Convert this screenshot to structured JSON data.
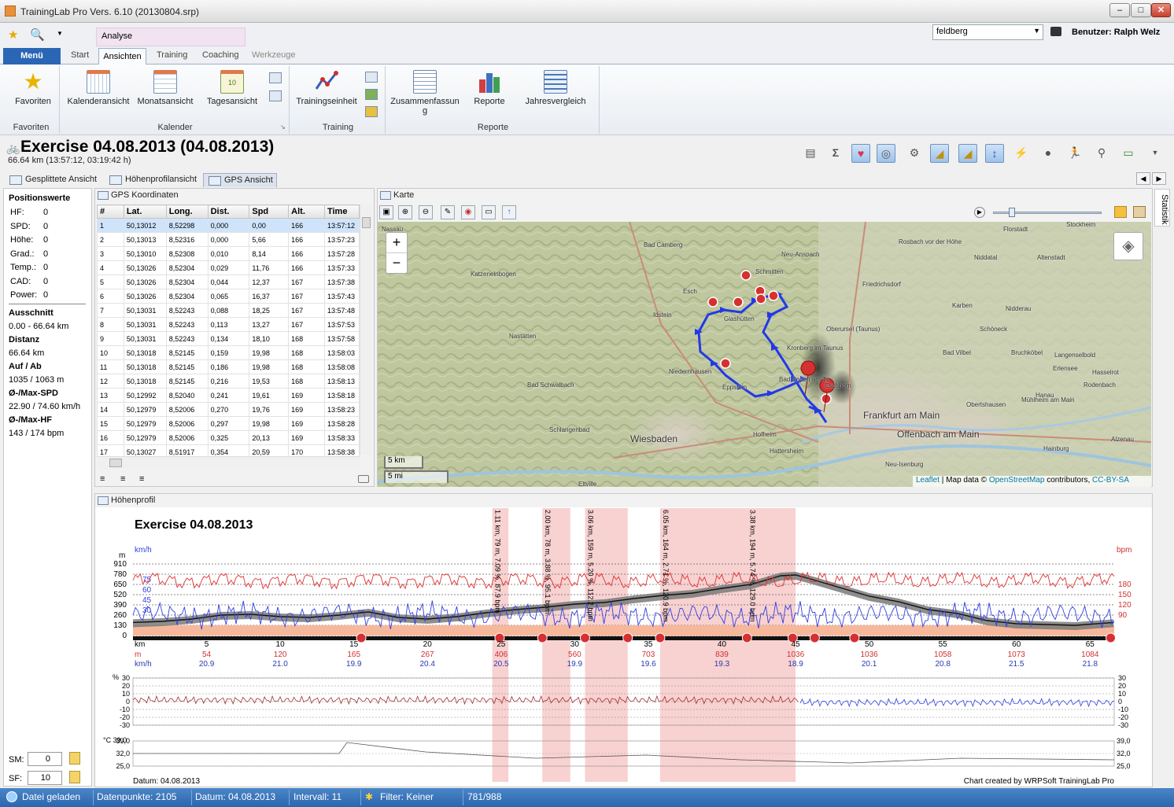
{
  "window": {
    "title": "TrainingLab Pro Vers. 6.10 (20130804.srp)",
    "min": "–",
    "max": "□",
    "close": "✕"
  },
  "context_tab": "Analyse",
  "profile_select": "feldberg",
  "user": "Benutzer: Ralph Welz",
  "tabs": {
    "menu": "Menü",
    "items": [
      "Start",
      "Ansichten",
      "Training",
      "Coaching",
      "Werkzeuge"
    ]
  },
  "ribbon": {
    "favoriten": {
      "button": "Favoriten",
      "group": "Favoriten"
    },
    "kalender": {
      "buttons": [
        "Kalenderansicht",
        "Monatsansicht",
        "Tagesansicht"
      ],
      "group": "Kalender"
    },
    "training": {
      "button": "Trainingseinheit",
      "group": "Training"
    },
    "reporte": {
      "buttons": [
        "Zusammenfassung",
        "Reporte",
        "Jahresvergleich"
      ],
      "group": "Reporte"
    }
  },
  "exercise": {
    "title": "Exercise 04.08.2013 (04.08.2013)",
    "subtitle": "66.64 km (13:57:12, 03:19:42 h)"
  },
  "view_tabs": [
    "Gesplittete Ansicht",
    "Höhenprofilansicht",
    "GPS Ansicht"
  ],
  "left_panel": {
    "title": "Positionswerte",
    "rows": [
      {
        "label": "HF:",
        "value": "0"
      },
      {
        "label": "SPD:",
        "value": "0"
      },
      {
        "label": "Höhe:",
        "value": "0"
      },
      {
        "label": "Grad.:",
        "value": "0"
      },
      {
        "label": "Temp.:",
        "value": "0"
      },
      {
        "label": "CAD:",
        "value": "0"
      },
      {
        "label": "Power:",
        "value": "0"
      }
    ],
    "sections": [
      {
        "head": "Ausschnitt",
        "value": "0.00 - 66.64 km"
      },
      {
        "head": "Distanz",
        "value": "66.64 km"
      },
      {
        "head": "Auf / Ab",
        "value": "1035 / 1063 m"
      },
      {
        "head": "Ø-/Max-SPD",
        "value": "22.90 / 74.60 km/h"
      },
      {
        "head": "Ø-/Max-HF",
        "value": "143 / 174 bpm"
      }
    ],
    "sm_label": "SM:",
    "sm_value": "0",
    "sf_label": "SF:",
    "sf_value": "10"
  },
  "gps": {
    "title": "GPS Koordinaten",
    "columns": [
      "#",
      "Lat.",
      "Long.",
      "Dist.",
      "Spd",
      "Alt.",
      "Time"
    ],
    "rows": [
      [
        "1",
        "50,13012",
        "8,52298",
        "0,000",
        "0,00",
        "166",
        "13:57:12"
      ],
      [
        "2",
        "50,13013",
        "8,52316",
        "0,000",
        "5,66",
        "166",
        "13:57:23"
      ],
      [
        "3",
        "50,13010",
        "8,52308",
        "0,010",
        "8,14",
        "166",
        "13:57:28"
      ],
      [
        "4",
        "50,13026",
        "8,52304",
        "0,029",
        "11,76",
        "166",
        "13:57:33"
      ],
      [
        "5",
        "50,13026",
        "8,52304",
        "0,044",
        "12,37",
        "167",
        "13:57:38"
      ],
      [
        "6",
        "50,13026",
        "8,52304",
        "0,065",
        "16,37",
        "167",
        "13:57:43"
      ],
      [
        "7",
        "50,13031",
        "8,52243",
        "0,088",
        "18,25",
        "167",
        "13:57:48"
      ],
      [
        "8",
        "50,13031",
        "8,52243",
        "0,113",
        "13,27",
        "167",
        "13:57:53"
      ],
      [
        "9",
        "50,13031",
        "8,52243",
        "0,134",
        "18,10",
        "168",
        "13:57:58"
      ],
      [
        "10",
        "50,13018",
        "8,52145",
        "0,159",
        "19,98",
        "168",
        "13:58:03"
      ],
      [
        "11",
        "50,13018",
        "8,52145",
        "0,186",
        "19,98",
        "168",
        "13:58:08"
      ],
      [
        "12",
        "50,13018",
        "8,52145",
        "0,216",
        "19,53",
        "168",
        "13:58:13"
      ],
      [
        "13",
        "50,12992",
        "8,52040",
        "0,241",
        "19,61",
        "169",
        "13:58:18"
      ],
      [
        "14",
        "50,12979",
        "8,52006",
        "0,270",
        "19,76",
        "169",
        "13:58:23"
      ],
      [
        "15",
        "50,12979",
        "8,52006",
        "0,297",
        "19,98",
        "169",
        "13:58:28"
      ],
      [
        "16",
        "50,12979",
        "8,52006",
        "0,325",
        "20,13",
        "169",
        "13:58:33"
      ],
      [
        "17",
        "50,13027",
        "8,51917",
        "0,354",
        "20,59",
        "170",
        "13:58:38"
      ]
    ]
  },
  "map": {
    "title": "Karte",
    "zoom_in": "+",
    "zoom_out": "−",
    "scale_km": "5 km",
    "scale_mi": "5 mi",
    "attribution": {
      "leaflet": "Leaflet",
      "mid": " | Map data © ",
      "osm": "OpenStreetMap",
      "contrib": " contributors, ",
      "license": "CC-BY-SA"
    },
    "places": [
      {
        "name": "Bad Camberg",
        "size": "s"
      },
      {
        "name": "Neu-Anspach",
        "size": "s"
      },
      {
        "name": "Rosbach vor der Höhe",
        "size": "s"
      },
      {
        "name": "Florstadt",
        "size": "s"
      },
      {
        "name": "Katzenelnbogen",
        "size": "s"
      },
      {
        "name": "Friedrichsdorf",
        "size": "s"
      },
      {
        "name": "Altenstadt",
        "size": "s"
      },
      {
        "name": "Stockheim",
        "size": "s"
      },
      {
        "name": "Niddatal",
        "size": "s"
      },
      {
        "name": "Esch",
        "size": "s"
      },
      {
        "name": "Schmitten",
        "size": "s"
      },
      {
        "name": "Idstein",
        "size": "s"
      },
      {
        "name": "Glashütten",
        "size": "s"
      },
      {
        "name": "Karben",
        "size": "s"
      },
      {
        "name": "Nidderau",
        "size": "s"
      },
      {
        "name": "Oberursel (Taunus)",
        "size": "s"
      },
      {
        "name": "Schöneck",
        "size": "s"
      },
      {
        "name": "Nastätten",
        "size": "s"
      },
      {
        "name": "Kronberg im Taunus",
        "size": "s"
      },
      {
        "name": "Bad Vilbel",
        "size": "s"
      },
      {
        "name": "Bruchköbel",
        "size": "s"
      },
      {
        "name": "Langenselbold",
        "size": "s"
      },
      {
        "name": "Niedernhausen",
        "size": "s"
      },
      {
        "name": "Erlensee",
        "size": "s"
      },
      {
        "name": "Hasselrot",
        "size": "s"
      },
      {
        "name": "Bad Schwalbach",
        "size": "s"
      },
      {
        "name": "Eppstein",
        "size": "s"
      },
      {
        "name": "Rodenbach",
        "size": "s"
      },
      {
        "name": "Hanau",
        "size": "s"
      },
      {
        "name": "Frankfurt am Main",
        "size": "l"
      },
      {
        "name": "Mühlheim am Main",
        "size": "s"
      },
      {
        "name": "Schlangenbad",
        "size": "s"
      },
      {
        "name": "Wiesbaden",
        "size": "l"
      },
      {
        "name": "Hofheim",
        "size": "s"
      },
      {
        "name": "Offenbach am Main",
        "size": "l"
      },
      {
        "name": "Obertshausen",
        "size": "s"
      },
      {
        "name": "Alzenau",
        "size": "s"
      },
      {
        "name": "Hattersheim",
        "size": "s"
      },
      {
        "name": "Hainburg",
        "size": "s"
      },
      {
        "name": "Neu-Isenburg",
        "size": "s"
      },
      {
        "name": "Eltville",
        "size": "s"
      },
      {
        "name": "Eschborn",
        "size": "s"
      },
      {
        "name": "Bad Soden am Ts.",
        "size": "s"
      },
      {
        "name": "Nassau",
        "size": "s"
      }
    ]
  },
  "statistik": "Statistik",
  "profile": {
    "panel_title": "Höhenprofil",
    "chart_title": "Exercise 04.08.2013",
    "left_axis_unit_top": "m",
    "left_axis_unit_speed": "km/h",
    "right_axis_unit": "bpm",
    "footer_left": "Datum: 04.08.2013",
    "footer_right": "Chart created by WRPSoft TrainingLab Pro"
  },
  "chart_data": [
    {
      "type": "area",
      "title": "Exercise 04.08.2013",
      "ylabel": "m",
      "y_ticks": [
        0,
        130,
        260,
        390,
        520,
        650,
        780,
        910
      ],
      "speed_ticks": [
        30,
        45,
        60,
        75
      ],
      "hr_ticks": [
        90,
        120,
        150,
        180
      ],
      "x_ticks": [
        5,
        10,
        15,
        20,
        25,
        30,
        35,
        40,
        45,
        50,
        55,
        60,
        65
      ],
      "x_unit": "km",
      "elevation_row": [
        "54",
        "120",
        "165",
        "267",
        "406",
        "560",
        "703",
        "839",
        "1036",
        "1036",
        "1058",
        "1073",
        "1084"
      ],
      "speed_row": [
        "20.9",
        "21.0",
        "19.9",
        "20.4",
        "20.5",
        "19.9",
        "19.6",
        "19.3",
        "18.9",
        "20.1",
        "20.8",
        "21.5",
        "21.8"
      ],
      "row_labels": [
        "km",
        "m",
        "km/h"
      ],
      "altitude_profile": {
        "x_km": [
          0,
          2,
          4,
          6,
          8,
          10,
          12,
          14,
          16,
          18,
          20,
          22,
          24,
          26,
          28,
          30,
          32,
          34,
          36,
          38,
          40,
          42,
          44,
          45,
          46,
          48,
          50,
          52,
          54,
          56,
          58,
          60,
          62,
          64,
          66.6
        ],
        "alt_m": [
          166,
          180,
          210,
          260,
          270,
          240,
          230,
          260,
          300,
          230,
          210,
          240,
          290,
          330,
          360,
          400,
          420,
          470,
          510,
          540,
          600,
          650,
          760,
          770,
          720,
          610,
          500,
          430,
          330,
          280,
          190,
          150,
          140,
          130,
          166
        ]
      },
      "laps": [
        {
          "label": "1.11 km, 79 m, 7.09 %, 87.9 bpm",
          "from_km": 24.4,
          "to_km": 25.5
        },
        {
          "label": "2.00 km, 78 m, 3.88 %, 95.1 bpm",
          "from_km": 27.8,
          "to_km": 29.7
        },
        {
          "label": "3.06 km, 159 m, 5.20 %, 112.2 bpm",
          "from_km": 30.7,
          "to_km": 33.6
        },
        {
          "label": "6.05 km, 164 m, 2.71 %, 120.9 bpm",
          "from_km": 35.8,
          "to_km": 41.7
        },
        {
          "label": "3.38 km, 194 m, 5.74 %, 129.0 bpm",
          "from_km": 41.7,
          "to_km": 45.0
        }
      ]
    },
    {
      "type": "line",
      "ylabel": "%",
      "y_ticks": [
        -30,
        -20,
        -10,
        0,
        10,
        20,
        30
      ]
    },
    {
      "type": "line",
      "ylabel": "°C",
      "y_tick_labels": [
        "25,0",
        "32,0",
        "39,0"
      ],
      "temp_left_label": "39,0"
    }
  ],
  "status": {
    "loaded": "Datei geladen",
    "points": "Datenpunkte: 2105",
    "date": "Datum: 04.08.2013",
    "interval": "Intervall: 11",
    "filter": "Filter: Keiner",
    "range": "781/988"
  },
  "colors": {
    "route": "#2239e8",
    "hr": "#e03030",
    "speed": "#3040e0",
    "lap": "#f4b8b8",
    "statusbar": "#2b66ae"
  }
}
